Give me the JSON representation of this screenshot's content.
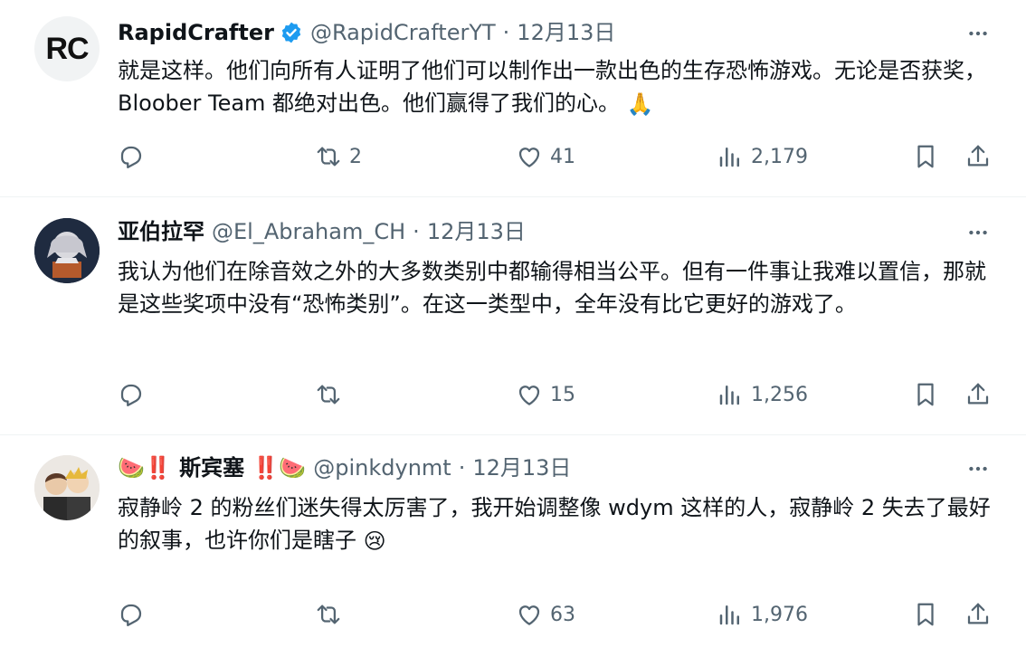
{
  "tweets": [
    {
      "name": "RapidCrafter",
      "handle": "@RapidCrafterYT",
      "separator": "·",
      "date": "12月13日",
      "avatar_text": "RC",
      "text": "就是这样。他们向所有人证明了他们可以制作出一款出色的生存恐怖游戏。无论是否获奖，Bloober Team 都绝对出色。他们赢得了我们的心。",
      "emoji": "🙏",
      "retweets": "2",
      "likes": "41",
      "views": "2,179",
      "verified": true
    },
    {
      "name": "亚伯拉罕",
      "handle": "@El_Abraham_CH",
      "separator": "·",
      "date": "12月13日",
      "text": "我认为他们在除音效之外的大多数类别中都输得相当公平。但有一件事让我难以置信，那就是这些奖项中没有“恐怖类别”。在这一类型中，全年没有比它更好的游戏了。",
      "retweets": "",
      "likes": "15",
      "views": "1,256"
    },
    {
      "name": "🍉‼️ 斯宾塞 ‼️🍉",
      "handle": "@pinkdynmt",
      "separator": "·",
      "date": "12月13日",
      "text": "寂静岭 2 的粉丝们迷失得太厉害了，我开始调整像 wdym 这样的人，寂静岭 2 失去了最好的叙事，也许你们是瞎子",
      "emoji": "😢",
      "retweets": "",
      "likes": "63",
      "views": "1,976"
    }
  ],
  "colors": {
    "text": "#0f1419",
    "secondary": "#536471",
    "verified": "#1d9bf0",
    "divider": "#eff3f4"
  },
  "icons": [
    "reply-icon",
    "retweet-icon",
    "like-icon",
    "views-icon",
    "bookmark-icon",
    "share-icon",
    "more-icon",
    "verified-badge-icon"
  ]
}
